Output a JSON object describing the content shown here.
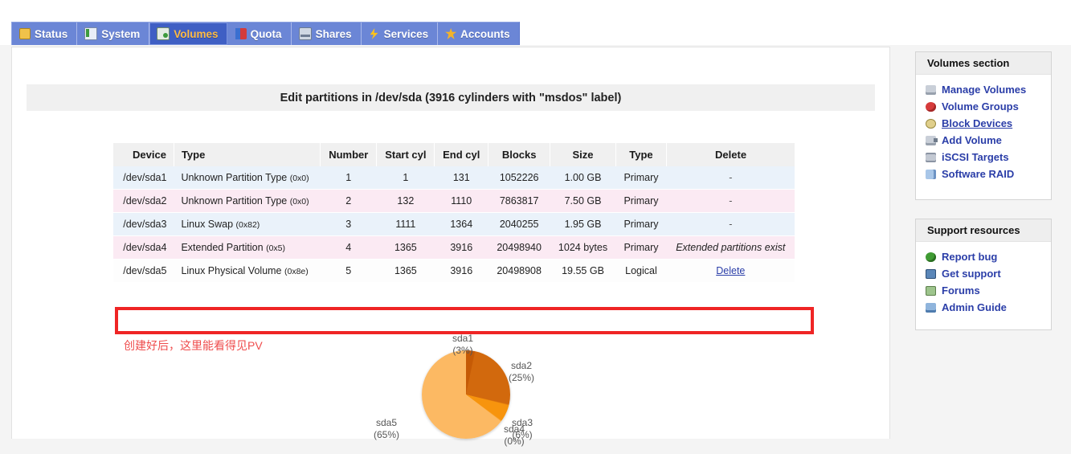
{
  "tabs": [
    {
      "label": "Status",
      "icon": "status-icon",
      "active": false
    },
    {
      "label": "System",
      "icon": "system-icon",
      "active": false
    },
    {
      "label": "Volumes",
      "icon": "volumes-icon",
      "active": true
    },
    {
      "label": "Quota",
      "icon": "quota-icon",
      "active": false
    },
    {
      "label": "Shares",
      "icon": "shares-icon",
      "active": false
    },
    {
      "label": "Services",
      "icon": "services-icon",
      "active": false
    },
    {
      "label": "Accounts",
      "icon": "accounts-icon",
      "active": false
    }
  ],
  "page": {
    "title": "Edit partitions in /dev/sda (3916 cylinders with \"msdos\" label)",
    "annotation": "创建好后，这里能看得见PV"
  },
  "table": {
    "headers": [
      "Device",
      "Type",
      "Number",
      "Start cyl",
      "End cyl",
      "Blocks",
      "Size",
      "Type",
      "Delete"
    ],
    "rows": [
      {
        "device": "/dev/sda1",
        "type": "Unknown Partition Type",
        "hex": "(0x0)",
        "number": "1",
        "start": "1",
        "end": "131",
        "blocks": "1052226",
        "size": "1.00 GB",
        "ptype": "Primary",
        "delete": "-",
        "delete_kind": "dash",
        "stripe": "blue",
        "highlighted": false
      },
      {
        "device": "/dev/sda2",
        "type": "Unknown Partition Type",
        "hex": "(0x0)",
        "number": "2",
        "start": "132",
        "end": "1110",
        "blocks": "7863817",
        "size": "7.50 GB",
        "ptype": "Primary",
        "delete": "-",
        "delete_kind": "dash",
        "stripe": "pink",
        "highlighted": false
      },
      {
        "device": "/dev/sda3",
        "type": "Linux Swap",
        "hex": "(0x82)",
        "number": "3",
        "start": "1111",
        "end": "1364",
        "blocks": "2040255",
        "size": "1.95 GB",
        "ptype": "Primary",
        "delete": "-",
        "delete_kind": "dash",
        "stripe": "blue",
        "highlighted": false
      },
      {
        "device": "/dev/sda4",
        "type": "Extended Partition",
        "hex": "(0x5)",
        "number": "4",
        "start": "1365",
        "end": "3916",
        "blocks": "20498940",
        "size": "1024 bytes",
        "ptype": "Primary",
        "delete": "Extended partitions exist",
        "delete_kind": "note",
        "stripe": "pink",
        "highlighted": false
      },
      {
        "device": "/dev/sda5",
        "type": "Linux Physical Volume",
        "hex": "(0x8e)",
        "number": "5",
        "start": "1365",
        "end": "3916",
        "blocks": "20498908",
        "size": "19.55 GB",
        "ptype": "Logical",
        "delete": "Delete",
        "delete_kind": "link",
        "stripe": "hl",
        "highlighted": true
      }
    ]
  },
  "chart_data": {
    "type": "pie",
    "title": "",
    "labels": [
      "sda1",
      "sda2",
      "sda3",
      "sda4",
      "sda5"
    ],
    "values": [
      3,
      25,
      6,
      0,
      65
    ],
    "value_unit": "%",
    "label_texts": {
      "sda1": "sda1\n(3%)",
      "sda2": "sda2\n(25%)",
      "sda3": "sda3\n(6%)",
      "sda4": "sda4\n(0%)",
      "sda5": "sda5\n(65%)"
    },
    "colors": [
      "#c55a05",
      "#d2690d",
      "#f7940d",
      "#f7940d",
      "#fcb963"
    ],
    "legend": "none"
  },
  "pie_labels": {
    "sda1_name": "sda1",
    "sda1_pct": "(3%)",
    "sda2_name": "sda2",
    "sda2_pct": "(25%)",
    "sda3_name": "sda3",
    "sda3_pct": "(6%)",
    "sda4_name": "sda4",
    "sda4_pct": "(0%)",
    "sda5_name": "sda5",
    "sda5_pct": "(65%)"
  },
  "sidebar": {
    "sections": [
      {
        "title": "Volumes section",
        "items": [
          {
            "label": "Manage Volumes",
            "icon": "manage-volumes-icon",
            "hovered": false
          },
          {
            "label": "Volume Groups",
            "icon": "volume-groups-icon",
            "hovered": false
          },
          {
            "label": "Block Devices",
            "icon": "block-devices-icon",
            "hovered": true
          },
          {
            "label": "Add Volume",
            "icon": "add-volume-icon",
            "hovered": false
          },
          {
            "label": "iSCSI Targets",
            "icon": "iscsi-targets-icon",
            "hovered": false
          },
          {
            "label": "Software RAID",
            "icon": "software-raid-icon",
            "hovered": false
          }
        ]
      },
      {
        "title": "Support resources",
        "items": [
          {
            "label": "Report bug",
            "icon": "report-bug-icon",
            "hovered": false
          },
          {
            "label": "Get support",
            "icon": "get-support-icon",
            "hovered": false
          },
          {
            "label": "Forums",
            "icon": "forums-icon",
            "hovered": false
          },
          {
            "label": "Admin Guide",
            "icon": "admin-guide-icon",
            "hovered": false
          }
        ]
      }
    ]
  },
  "colors": {
    "tab_bar": "#6b86d6",
    "tab_active": "#3f5fc4",
    "tab_active_text": "#ffbb44",
    "link": "#2b3ea8",
    "highlight_box": "#ef2525",
    "annotation": "#ef4d4d"
  }
}
